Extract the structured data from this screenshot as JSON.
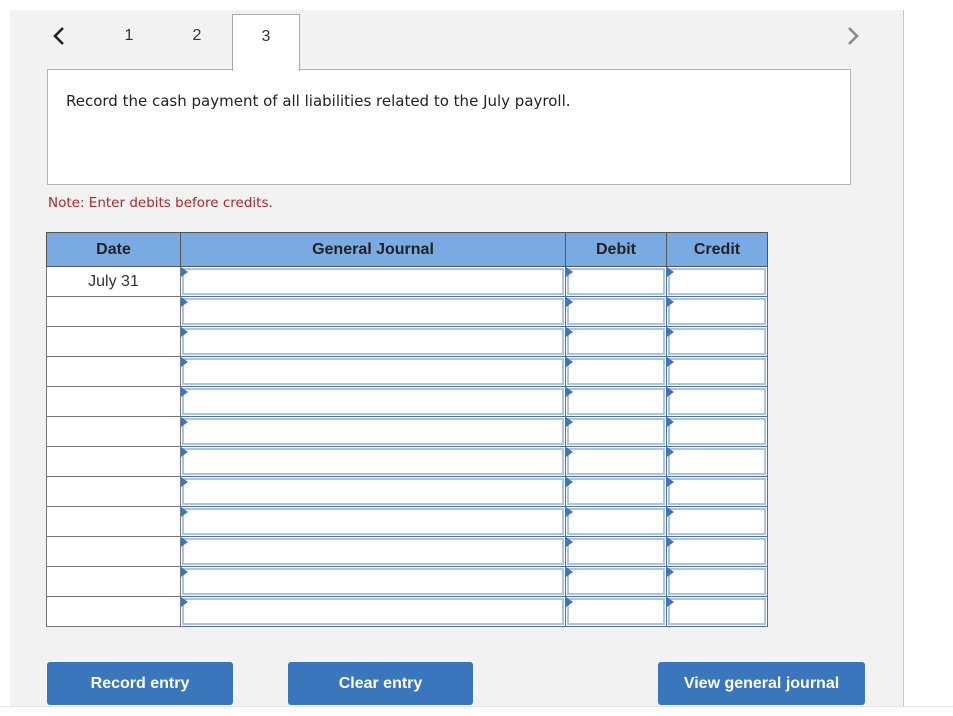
{
  "navigation": {
    "prev_icon": "chevron-left-icon",
    "next_icon": "chevron-right-icon",
    "tabs": [
      {
        "label": "1",
        "active": false
      },
      {
        "label": "2",
        "active": false
      },
      {
        "label": "3",
        "active": true
      }
    ]
  },
  "prompt": {
    "text": "Record the cash payment of all liabilities related to the July payroll."
  },
  "note": "Note: Enter debits before credits.",
  "journal": {
    "headers": {
      "date": "Date",
      "general_journal": "General Journal",
      "debit": "Debit",
      "credit": "Credit"
    },
    "rows": [
      {
        "date": "July 31",
        "account": "",
        "debit": "",
        "credit": ""
      },
      {
        "date": "",
        "account": "",
        "debit": "",
        "credit": ""
      },
      {
        "date": "",
        "account": "",
        "debit": "",
        "credit": ""
      },
      {
        "date": "",
        "account": "",
        "debit": "",
        "credit": ""
      },
      {
        "date": "",
        "account": "",
        "debit": "",
        "credit": ""
      },
      {
        "date": "",
        "account": "",
        "debit": "",
        "credit": ""
      },
      {
        "date": "",
        "account": "",
        "debit": "",
        "credit": ""
      },
      {
        "date": "",
        "account": "",
        "debit": "",
        "credit": ""
      },
      {
        "date": "",
        "account": "",
        "debit": "",
        "credit": ""
      },
      {
        "date": "",
        "account": "",
        "debit": "",
        "credit": ""
      },
      {
        "date": "",
        "account": "",
        "debit": "",
        "credit": ""
      },
      {
        "date": "",
        "account": "",
        "debit": "",
        "credit": ""
      }
    ]
  },
  "buttons": {
    "record_entry": "Record entry",
    "clear_entry": "Clear entry",
    "view_general_journal": "View general journal"
  },
  "colors": {
    "header_blue": "#79abe2",
    "button_blue": "#3a76bb",
    "note_red": "#b1262a"
  }
}
